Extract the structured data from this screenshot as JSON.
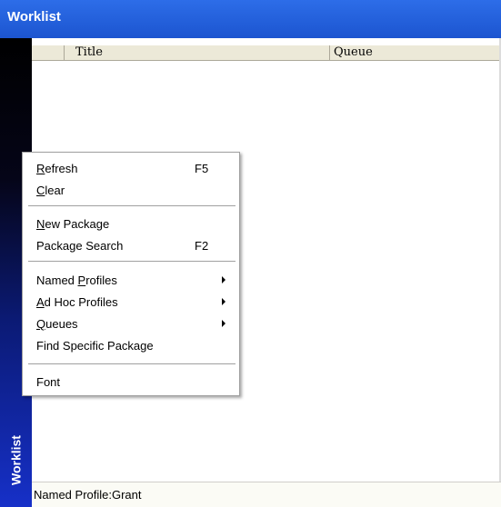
{
  "window": {
    "title": "Worklist"
  },
  "sidebar": {
    "label": "Worklist"
  },
  "list": {
    "columns": [
      {
        "label": ""
      },
      {
        "label": "Title"
      },
      {
        "label": "Queue"
      }
    ]
  },
  "context_menu": {
    "items": [
      {
        "pre": "",
        "mnemonic": "R",
        "post": "efresh",
        "shortcut": "F5"
      },
      {
        "pre": "",
        "mnemonic": "C",
        "post": "lear"
      },
      {
        "pre": "",
        "mnemonic": "N",
        "post": "ew Package"
      },
      {
        "pre": "Package Search",
        "mnemonic": "",
        "post": "",
        "shortcut": "F2"
      },
      {
        "pre": "Named ",
        "mnemonic": "P",
        "post": "rofiles",
        "submenu": true
      },
      {
        "pre": "",
        "mnemonic": "A",
        "post": "d Hoc Profiles",
        "submenu": true
      },
      {
        "pre": "",
        "mnemonic": "Q",
        "post": "ueues",
        "submenu": true
      },
      {
        "pre": "Find Specific Package",
        "mnemonic": "",
        "post": ""
      },
      {
        "pre": "Font",
        "mnemonic": "",
        "post": ""
      }
    ]
  },
  "status": {
    "text": "Named Profile:Grant"
  }
}
